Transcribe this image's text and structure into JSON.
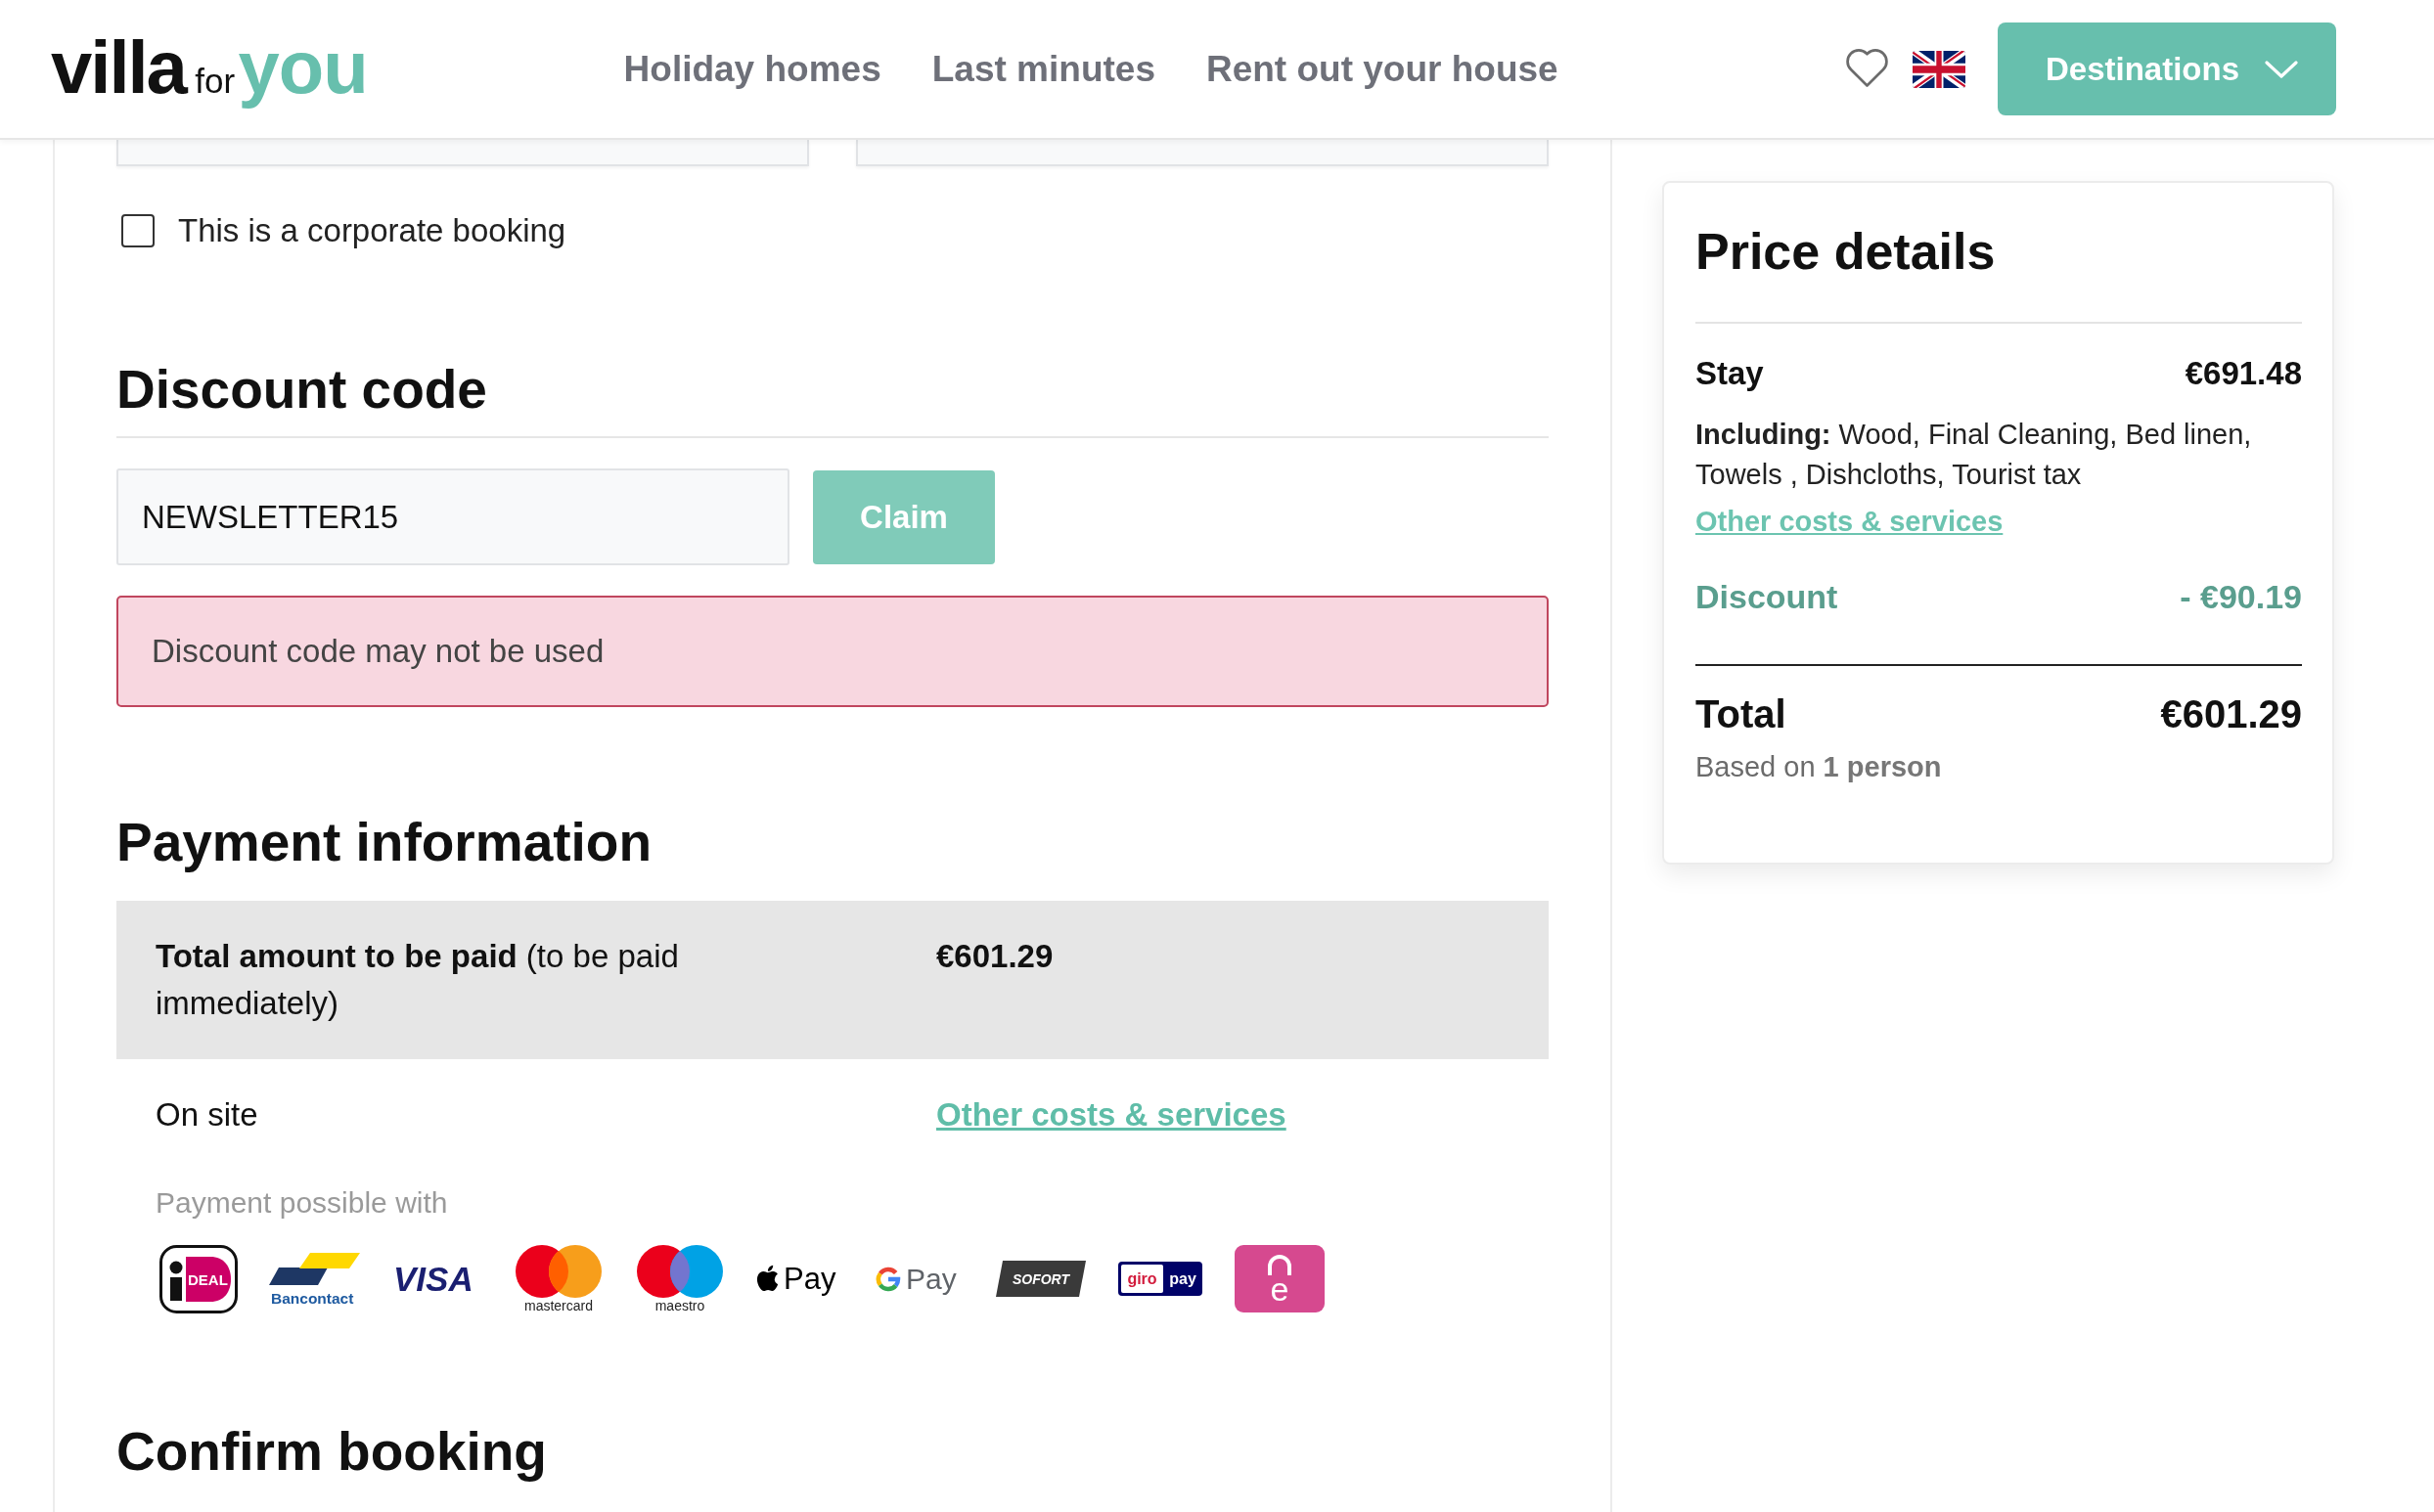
{
  "header": {
    "logo": {
      "parts": [
        "villa",
        "for",
        "you"
      ]
    },
    "nav": [
      {
        "label": "Holiday homes"
      },
      {
        "label": "Last minutes"
      },
      {
        "label": "Rent out your house"
      }
    ],
    "destinations_button": {
      "label": "Destinations"
    }
  },
  "booking_form": {
    "cut_off_fields": [
      {
        "kind": "input"
      },
      {
        "kind": "input"
      }
    ],
    "corporate_booking": {
      "label": "This is a corporate booking",
      "checked": false
    },
    "discount": {
      "heading": "Discount code",
      "code_field": {
        "value": "NEWSLETTER15"
      },
      "claim_button": {
        "label": "Claim",
        "disabled": true
      },
      "error": "Discount code may not be used"
    },
    "payment": {
      "heading": "Payment information",
      "rows": [
        {
          "kind": "due_now",
          "label": "**Total amount to be paid** (to be paid immediately)",
          "amount": "€601.29"
        },
        {
          "kind": "on_site",
          "label": "On site",
          "link": "Other costs & services"
        }
      ],
      "methods_label": "Payment possible with",
      "methods": [
        {
          "kind": "ideal",
          "texts": [
            "DEAL"
          ]
        },
        {
          "kind": "bancontact",
          "texts": [
            "Bancontact"
          ]
        },
        {
          "kind": "visa",
          "texts": [
            "VISA"
          ]
        },
        {
          "kind": "mastercard",
          "texts": [
            "mastercard"
          ]
        },
        {
          "kind": "maestro",
          "texts": [
            "maestro"
          ]
        },
        {
          "kind": "applepay",
          "texts": [
            "Pay"
          ]
        },
        {
          "kind": "googlepay",
          "texts": [
            "Pay"
          ]
        },
        {
          "kind": "sofort",
          "texts": [
            "SOFORT"
          ]
        },
        {
          "kind": "giropay",
          "texts": [
            "giro",
            "pay"
          ]
        },
        {
          "kind": "eps",
          "texts": [
            "e"
          ]
        }
      ]
    },
    "confirm": {
      "heading": "Confirm booking"
    }
  },
  "price_details": {
    "title": "Price details",
    "stay": {
      "label": "Stay",
      "amount": "€691.48"
    },
    "including": "**Including:** Wood, Final Cleaning, Bed linen, Towels , Dishcloths, Tourist tax",
    "costs_link": "Other costs & services",
    "discount": {
      "label": "Discount",
      "amount": "- €90.19"
    },
    "total": {
      "label": "Total",
      "amount": "€601.29"
    },
    "basis": "Based on **1 person**"
  }
}
